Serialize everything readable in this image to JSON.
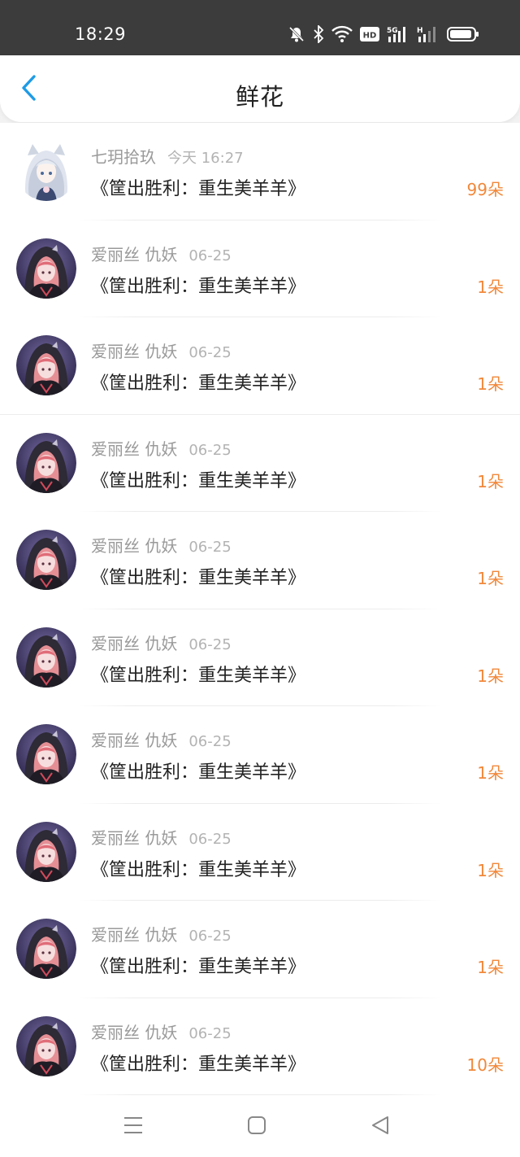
{
  "status_bar": {
    "time": "18:29",
    "icons": [
      "mute-icon",
      "bluetooth-icon",
      "wifi-icon",
      "hd-icon",
      "5g-signal-icon",
      "h-signal-icon",
      "battery-icon"
    ]
  },
  "header": {
    "title": "鲜花",
    "back_icon": "chevron-left-icon",
    "accent_color": "#1e9be6"
  },
  "list": {
    "flower_color": "#f1883a",
    "items": [
      {
        "user": "七玥拾玖",
        "date": "今天 16:27",
        "book": "《筐出胜利：重生美羊羊》",
        "flowers": "99朵",
        "avatar": "white-hair-girl"
      },
      {
        "user": "爱丽丝 仇妖",
        "date": "06-25",
        "book": "《筐出胜利：重生美羊羊》",
        "flowers": "1朵",
        "avatar": "hooded-girl"
      },
      {
        "user": "爱丽丝 仇妖",
        "date": "06-25",
        "book": "《筐出胜利：重生美羊羊》",
        "flowers": "1朵",
        "avatar": "hooded-girl"
      },
      {
        "user": "爱丽丝 仇妖",
        "date": "06-25",
        "book": "《筐出胜利：重生美羊羊》",
        "flowers": "1朵",
        "avatar": "hooded-girl"
      },
      {
        "user": "爱丽丝 仇妖",
        "date": "06-25",
        "book": "《筐出胜利：重生美羊羊》",
        "flowers": "1朵",
        "avatar": "hooded-girl"
      },
      {
        "user": "爱丽丝 仇妖",
        "date": "06-25",
        "book": "《筐出胜利：重生美羊羊》",
        "flowers": "1朵",
        "avatar": "hooded-girl"
      },
      {
        "user": "爱丽丝 仇妖",
        "date": "06-25",
        "book": "《筐出胜利：重生美羊羊》",
        "flowers": "1朵",
        "avatar": "hooded-girl"
      },
      {
        "user": "爱丽丝 仇妖",
        "date": "06-25",
        "book": "《筐出胜利：重生美羊羊》",
        "flowers": "1朵",
        "avatar": "hooded-girl"
      },
      {
        "user": "爱丽丝 仇妖",
        "date": "06-25",
        "book": "《筐出胜利：重生美羊羊》",
        "flowers": "1朵",
        "avatar": "hooded-girl"
      },
      {
        "user": "爱丽丝 仇妖",
        "date": "06-25",
        "book": "《筐出胜利：重生美羊羊》",
        "flowers": "10朵",
        "avatar": "hooded-girl"
      }
    ]
  },
  "nav_bar": {
    "icons": [
      "menu-icon",
      "home-square-icon",
      "back-triangle-icon"
    ]
  }
}
